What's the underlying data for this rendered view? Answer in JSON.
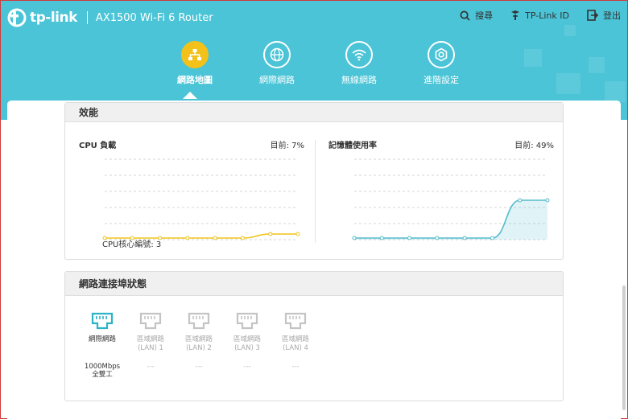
{
  "header": {
    "brand": "tp-link",
    "model": "AX1500 Wi-Fi 6 Router",
    "actions": [
      {
        "label": "搜尋",
        "icon": "search-icon"
      },
      {
        "label": "TP-Link ID",
        "icon": "tplink-id-icon"
      },
      {
        "label": "登出",
        "icon": "logout-icon"
      }
    ]
  },
  "nav": [
    {
      "label": "網路地圖",
      "icon": "network-map-icon",
      "active": true
    },
    {
      "label": "網際網路",
      "icon": "globe-icon",
      "active": false
    },
    {
      "label": "無線網路",
      "icon": "wifi-icon",
      "active": false
    },
    {
      "label": "進階設定",
      "icon": "gear-icon",
      "active": false
    }
  ],
  "performance": {
    "title": "效能",
    "cpu": {
      "label": "CPU 負載",
      "current_label": "目前: 7%",
      "values": [
        2,
        2,
        2,
        2,
        2,
        2,
        7,
        7
      ],
      "ylim": [
        0,
        100
      ],
      "cores_label": "CPU核心編號: 3"
    },
    "memory": {
      "label": "記憶體使用率",
      "current_label": "目前: 49%",
      "values": [
        2,
        2,
        2,
        2,
        2,
        2,
        49,
        49
      ],
      "ylim": [
        0,
        100
      ]
    }
  },
  "ports": {
    "title": "網路連接埠狀態",
    "items": [
      {
        "name": "網際網路",
        "status": "1000Mbps\n全雙工",
        "connected": true
      },
      {
        "name": "區域網路\n(LAN) 1",
        "status": "---",
        "connected": false
      },
      {
        "name": "區域網路\n(LAN) 2",
        "status": "---",
        "connected": false
      },
      {
        "name": "區域網路\n(LAN) 3",
        "status": "---",
        "connected": false
      },
      {
        "name": "區域網路\n(LAN) 4",
        "status": "---",
        "connected": false
      }
    ]
  },
  "colors": {
    "header_bg": "#4ac4d6",
    "active_nav": "#f2c21b",
    "cpu_line": "#f0c419",
    "memory_line": "#54bccb",
    "port_active": "#2bb3c6",
    "port_inactive": "#c4c4c4"
  }
}
